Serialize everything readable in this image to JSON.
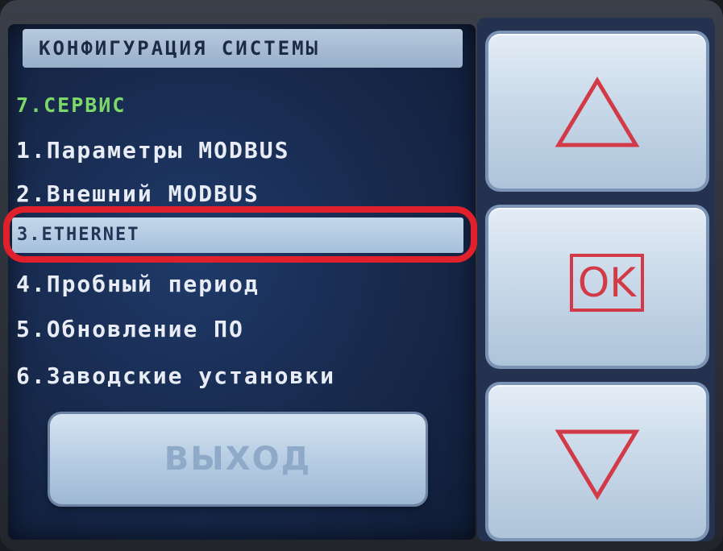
{
  "panel": {
    "title": "КОНФИГУРАЦИЯ СИСТЕМЫ"
  },
  "menu": {
    "section": "7.СЕРВИС",
    "items": [
      {
        "label": "1.Параметры MODBUS"
      },
      {
        "label": "2.Внешний MODBUS"
      },
      {
        "label": "3.ETHERNET",
        "selected": true
      },
      {
        "label": "4.Пробный период"
      },
      {
        "label": "5.Обновление ПО"
      },
      {
        "label": "6.Заводские установки"
      }
    ]
  },
  "buttons": {
    "exit_label": "ВЫХОД",
    "ok_label": "OK",
    "up_icon": "triangle-up-icon",
    "down_icon": "triangle-down-icon"
  },
  "colors": {
    "selection_ring": "#e0202a",
    "section_text": "#7dd86a",
    "nav_symbol": "#d23a48"
  }
}
